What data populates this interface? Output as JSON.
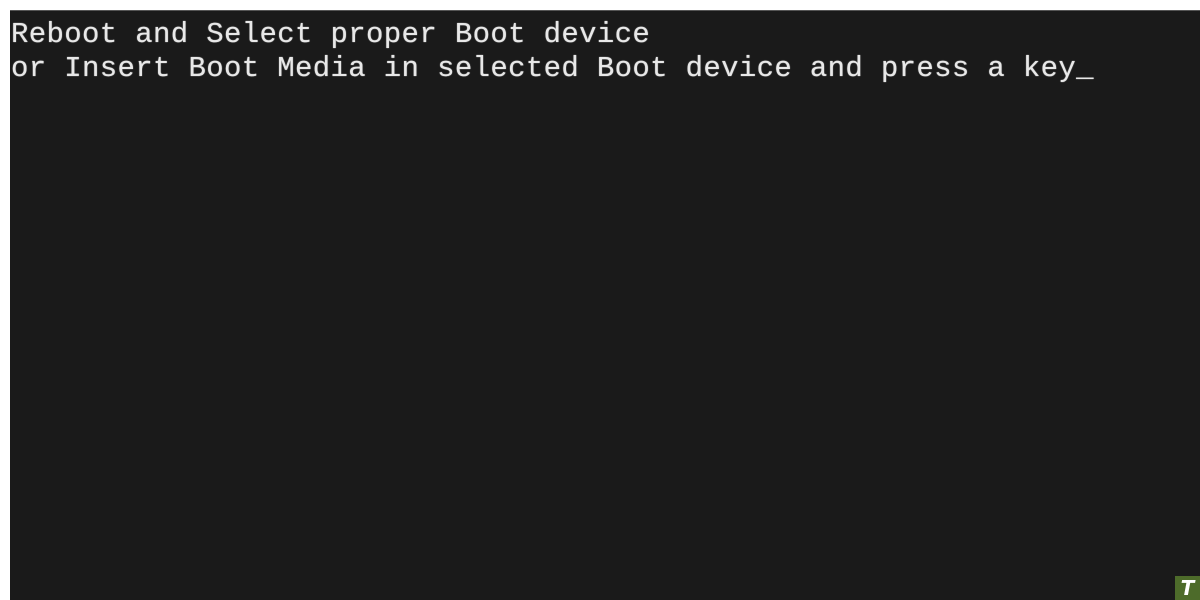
{
  "screen": {
    "lines": [
      "Reboot and Select proper Boot device",
      "or Insert Boot Media in selected Boot device and press a key"
    ],
    "cursor": "_",
    "background_color": "#1a1a1a",
    "text_color": "#e8e8e8"
  },
  "watermark": {
    "icon": "T",
    "color": "#4d6b2a"
  }
}
